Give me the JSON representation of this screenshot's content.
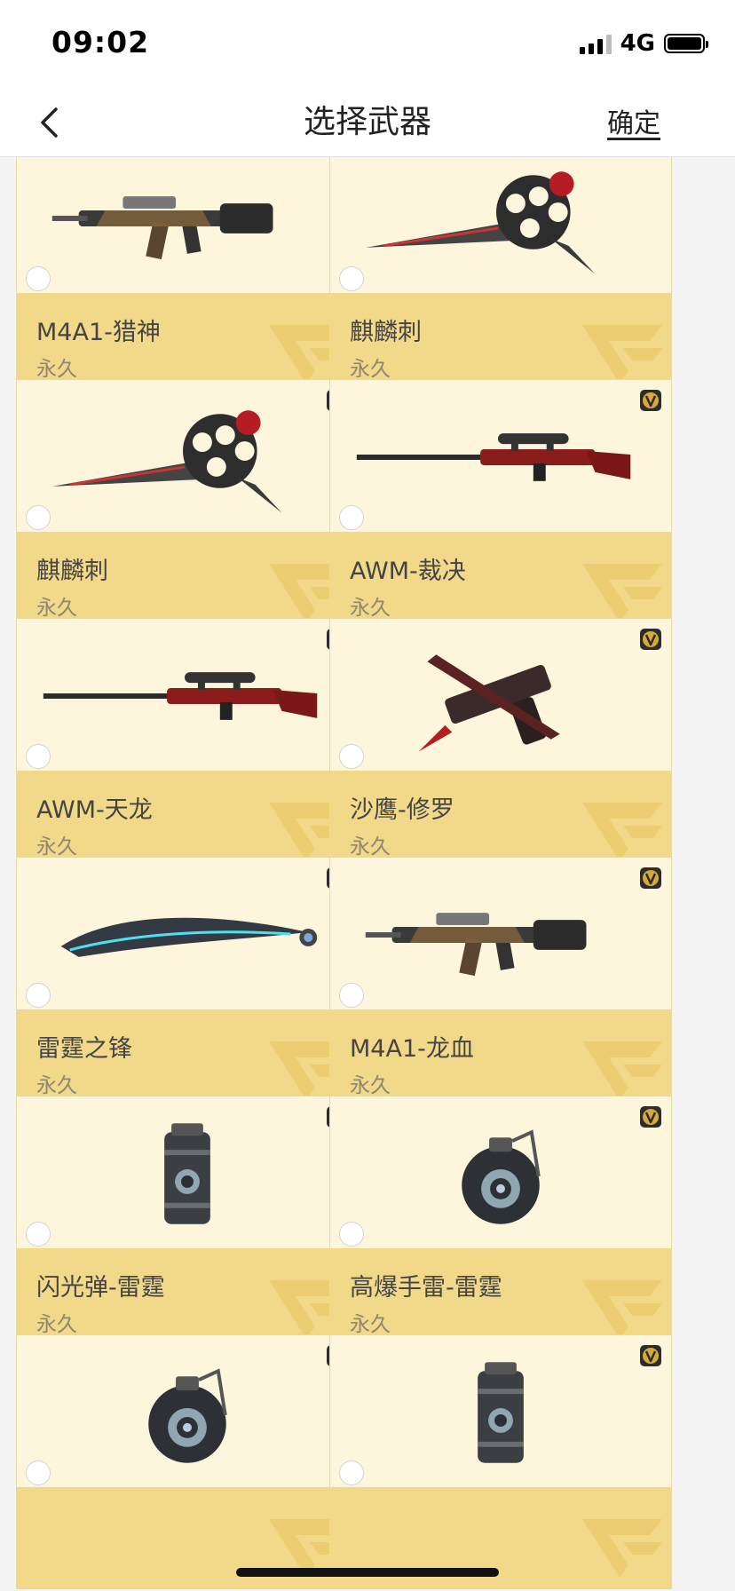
{
  "status_bar": {
    "time": "09:02",
    "network": "4G"
  },
  "header": {
    "title": "选择武器",
    "confirm_label": "确定"
  },
  "weapons": [
    {
      "name": "M4A1-猎神",
      "duration": "永久",
      "icon": "rifle-icon",
      "vip": false
    },
    {
      "name": "麒麟刺",
      "duration": "永久",
      "icon": "knuckle-blade-icon",
      "vip": false
    },
    {
      "name": "麒麟刺",
      "duration": "永久",
      "icon": "knuckle-blade-icon",
      "vip": true
    },
    {
      "name": "AWM-裁决",
      "duration": "永久",
      "icon": "sniper-rifle-icon",
      "vip": true
    },
    {
      "name": "AWM-天龙",
      "duration": "永久",
      "icon": "sniper-rifle-icon",
      "vip": true
    },
    {
      "name": "沙鹰-修罗",
      "duration": "永久",
      "icon": "pistol-icon",
      "vip": true
    },
    {
      "name": "雷霆之锋",
      "duration": "永久",
      "icon": "blade-icon",
      "vip": true
    },
    {
      "name": "M4A1-龙血",
      "duration": "永久",
      "icon": "rifle-icon",
      "vip": true
    },
    {
      "name": "闪光弹-雷霆",
      "duration": "永久",
      "icon": "flashbang-icon",
      "vip": true
    },
    {
      "name": "高爆手雷-雷霆",
      "duration": "永久",
      "icon": "grenade-icon",
      "vip": true
    },
    {
      "name": "",
      "duration": "",
      "icon": "grenade-icon",
      "vip": true
    },
    {
      "name": "",
      "duration": "",
      "icon": "flashbang-icon",
      "vip": true
    }
  ],
  "colors": {
    "card_top": "#fdf6dd",
    "card_info": "#f2d98a",
    "watermark": "#e9c86a"
  }
}
